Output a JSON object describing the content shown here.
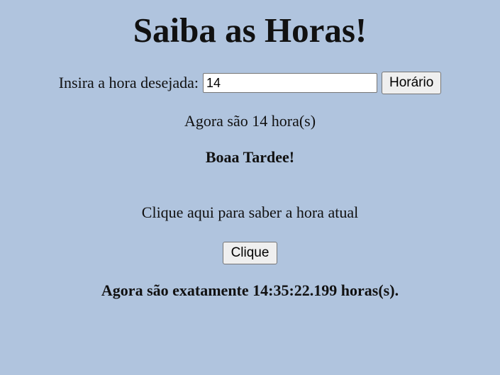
{
  "page": {
    "title": "Saiba as Horas!"
  },
  "hour_form": {
    "label": "Insira a hora desejada:",
    "input_value": "14",
    "button_label": "Horário"
  },
  "result": {
    "message": "Agora são 14 hora(s)",
    "greeting": "Boaa Tardee!"
  },
  "current_time": {
    "hint": "Clique aqui para saber a hora atual",
    "button_label": "Clique",
    "message": "Agora são exatamente 14:35:22.199 horas(s)."
  },
  "colors": {
    "background": "#b0c4de"
  }
}
